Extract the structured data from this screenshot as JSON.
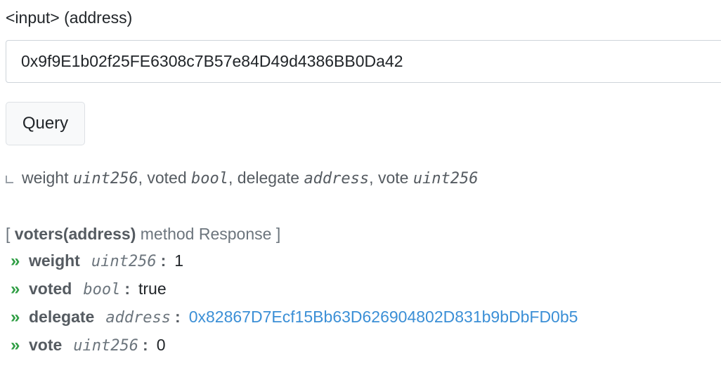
{
  "input": {
    "label": "<input> (address)",
    "value": "0x9f9E1b02f25FE6308c7B57e84D49d4386BB0Da42"
  },
  "query_button": {
    "label": "Query"
  },
  "signature": {
    "parts": [
      {
        "name": "weight",
        "type": "uint256"
      },
      {
        "name": "voted",
        "type": "bool"
      },
      {
        "name": "delegate",
        "type": "address"
      },
      {
        "name": "vote",
        "type": "uint256"
      }
    ],
    "sep": ", "
  },
  "response": {
    "open": "[ ",
    "method": "voters(address)",
    "suffix": " method Response ]",
    "chevron": "»",
    "colon": ":",
    "rows": [
      {
        "name": "weight",
        "type": "uint256",
        "value": "1"
      },
      {
        "name": "voted",
        "type": "bool",
        "value": "true"
      },
      {
        "name": "delegate",
        "type": "address",
        "value": "0x82867D7Ecf15Bb63D626904802D831b9bDbFD0b5"
      },
      {
        "name": "vote",
        "type": "uint256",
        "value": "0"
      }
    ]
  },
  "colors": {
    "chevron": "#2f9e44",
    "link": "#3b8fd6"
  }
}
